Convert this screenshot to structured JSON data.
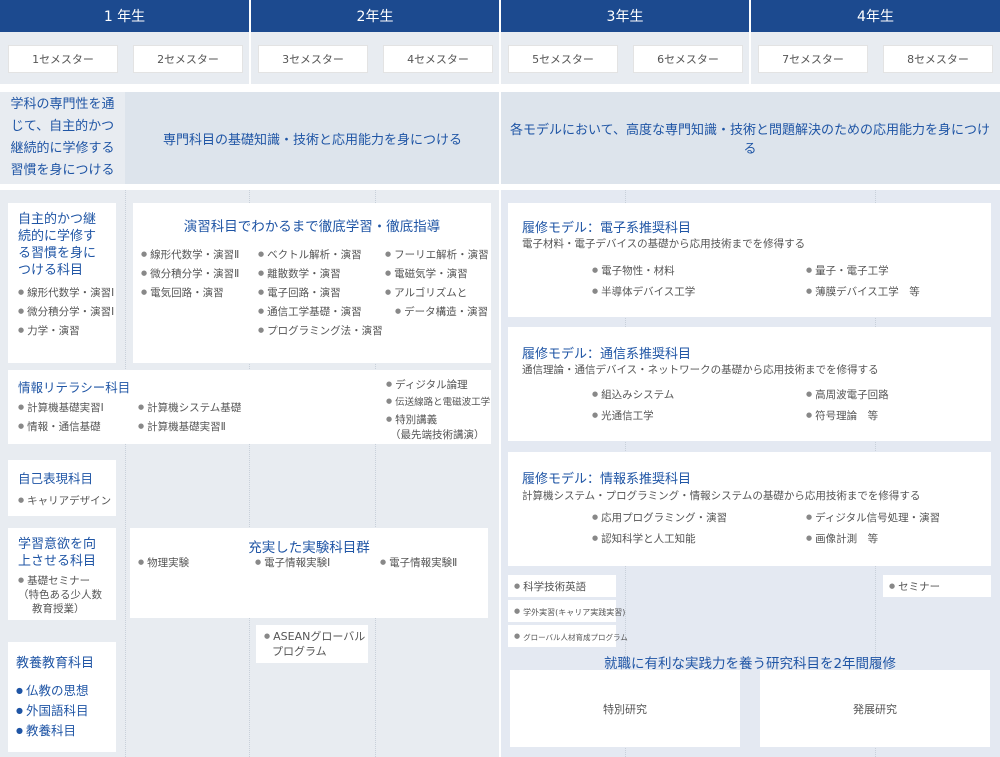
{
  "years": [
    "1 年生",
    "2年生",
    "3年生",
    "4年生"
  ],
  "semesters": [
    "1セメスター",
    "2セメスター",
    "3セメスター",
    "4セメスター",
    "5セメスター",
    "6セメスター",
    "7セメスター",
    "8セメスター"
  ],
  "goals": {
    "year1": "学科の専門性を通じて、自主的かつ継続的に学修する習慣を身につける",
    "year2": "専門科目の基礎知識・技術と応用能力を身につける",
    "year34": "各モデルにおいて、高度な専門知識・技術と問題解決のための応用能力を身につける"
  },
  "jishu": {
    "title": "自主的かつ継続的に学修する習慣を身につける科目",
    "items": [
      "線形代数学・演習Ⅰ",
      "微分積分学・演習Ⅰ",
      "力学・演習"
    ]
  },
  "enshu": {
    "title": "演習科目でわかるまで徹底学習・徹底指導",
    "col1": [
      "線形代数学・演習Ⅱ",
      "微分積分学・演習Ⅱ",
      "電気回路・演習"
    ],
    "col2": [
      "ベクトル解析・演習",
      "離散数学・演習",
      "電子回路・演習",
      "通信工学基礎・演習",
      "プログラミング法・演習"
    ],
    "col3": [
      "フーリエ解析・演習",
      "電磁気学・演習",
      "アルゴリズムと",
      "データ構造・演習"
    ]
  },
  "joho": {
    "title": "情報リテラシー科目",
    "col1": [
      "計算機基礎実習Ⅰ",
      "情報・通信基礎"
    ],
    "col2": [
      "計算機システム基礎",
      "計算機基礎実習Ⅱ"
    ],
    "col3": [
      "ディジタル論理",
      "伝送線路と電磁波工学",
      "特別講義",
      "（最先端技術講演）"
    ]
  },
  "jiko": {
    "title": "自己表現科目",
    "items": [
      "キャリアデザイン"
    ]
  },
  "gakushu": {
    "title": "学習意欲を向上させる科目",
    "item": "基礎セミナー",
    "note1": "（特色ある少人数",
    "note2": "教育授業）"
  },
  "kyoyo": {
    "title": "教養教育科目",
    "items": [
      "仏教の思想",
      "外国語科目",
      "教養科目"
    ]
  },
  "jikken": {
    "title": "充実した実験科目群",
    "items": [
      "物理実験",
      "電子情報実験Ⅰ",
      "電子情報実験Ⅱ"
    ]
  },
  "asean": {
    "line1": "ASEANグローバル",
    "line2": "プログラム"
  },
  "models": [
    {
      "title": "履修モデル：電子系推奨科目",
      "desc": "電子材料・電子デバイスの基礎から応用技術までを修得する",
      "items": [
        "電子物性・材料",
        "量子・電子工学",
        "半導体デバイス工学",
        "薄膜デバイス工学　等"
      ]
    },
    {
      "title": "履修モデル：通信系推奨科目",
      "desc": "通信理論・通信デバイス・ネットワークの基礎から応用技術までを修得する",
      "items": [
        "組込みシステム",
        "高周波電子回路",
        "光通信工学",
        "符号理論　等"
      ]
    },
    {
      "title": "履修モデル：情報系推奨科目",
      "desc": "計算機システム・プログラミング・情報システムの基礎から応用技術までを修得する",
      "items": [
        "応用プログラミング・演習",
        "ディジタル信号処理・演習",
        "認知科学と人工知能",
        "画像計測　等"
      ]
    }
  ],
  "small3": [
    "科学技術英語",
    "学外実習(キャリア実践実習)",
    "グローバル人材育成プログラム"
  ],
  "seminar": "セミナー",
  "research": {
    "title": "就職に有利な実践力を養う研究科目を2年間履修",
    "items": [
      "特別研究",
      "発展研究"
    ]
  }
}
